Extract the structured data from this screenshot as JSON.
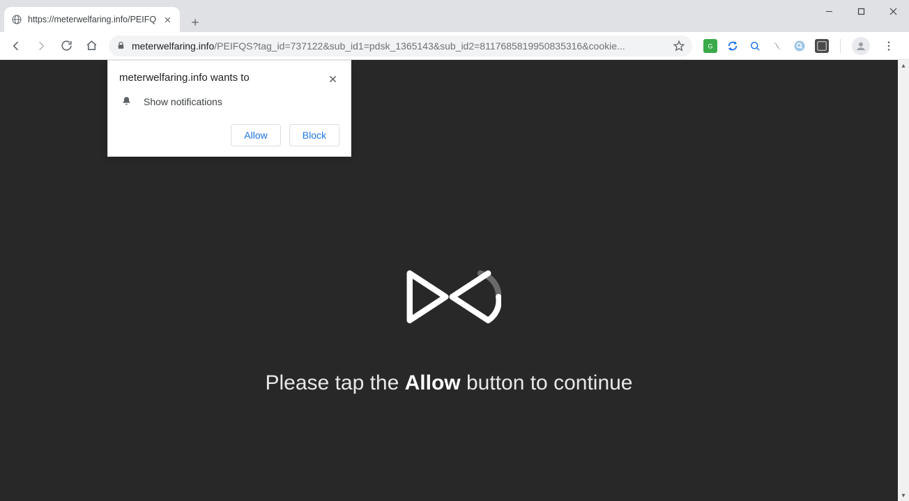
{
  "tab": {
    "title": "https://meterwelfaring.info/PEIFQ"
  },
  "url": {
    "host": "meterwelfaring.info",
    "path": "/PEIFQS?tag_id=737122&sub_id1=pdsk_1365143&sub_id2=8117685819950835316&cookie",
    "ellipsis": "..."
  },
  "permission": {
    "title": "meterwelfaring.info wants to",
    "option": "Show notifications",
    "allow": "Allow",
    "block": "Block"
  },
  "page": {
    "msg_before": "Please tap the ",
    "msg_bold": "Allow",
    "msg_after": " button to continue"
  }
}
